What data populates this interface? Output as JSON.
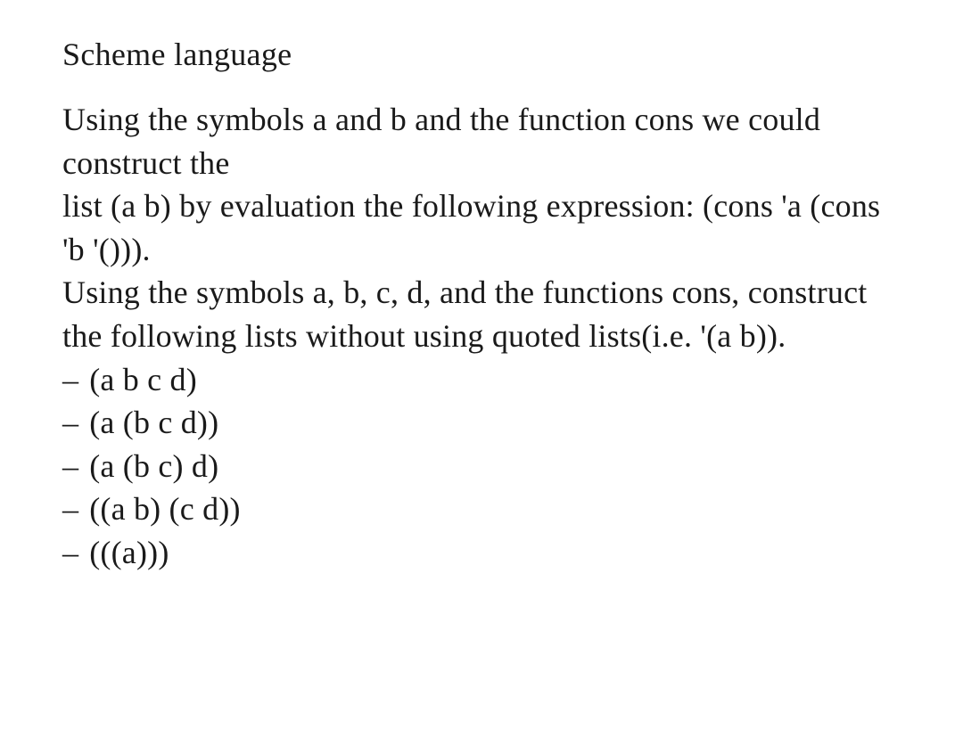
{
  "title": "Scheme language",
  "paragraph": {
    "line1": "Using the symbols a and b and the function cons we could construct the",
    "line2": "list (a b) by evaluation the following expression: (cons 'a (cons 'b '())).",
    "line3": "Using the symbols a, b, c, d, and the functions cons, construct the following lists without using quoted lists(i.e. '(a b))."
  },
  "items": {
    "0": "(a b c d)",
    "1": "(a (b c d))",
    "2": "(a (b c) d)",
    "3": "((a b) (c d))",
    "4": "(((a)))"
  },
  "bullet": "–"
}
